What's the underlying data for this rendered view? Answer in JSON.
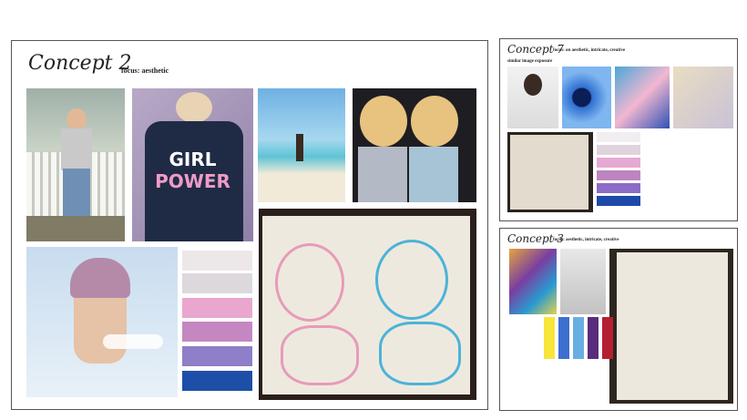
{
  "board_main": {
    "title": "Concept 2",
    "focus": "focus: aesthetic",
    "swatches": [
      "#ede7ea",
      "#dcd8db",
      "#e9a6cf",
      "#c487c1",
      "#8f7ec8",
      "#1e4fa8"
    ],
    "photos": [
      {
        "name": "girl-fence-photo",
        "text": ""
      },
      {
        "name": "girl-power-jacket-photo",
        "text": "GIRL\nPOWER"
      },
      {
        "name": "beach-photo",
        "text": ""
      },
      {
        "name": "twins-sunglasses-photo",
        "text": ""
      },
      {
        "name": "bandana-girl-photo",
        "text": ""
      },
      {
        "name": "sketchbook-drawing-photo",
        "text": ""
      }
    ]
  },
  "board_top_right": {
    "title": "Concept 7",
    "focus": "focus: on aesthetic, intricate, creative",
    "sub": "similar image exposure",
    "swatches": [
      "#f0eef0",
      "#e0d4dc",
      "#e6a9d3",
      "#be84bf",
      "#8c6cc6",
      "#1d49a8"
    ]
  },
  "board_bottom_right": {
    "title": "Concept 3",
    "focus": "focus: aesthetic, intricate, creative",
    "swatches": [
      "#f7e53a",
      "#3c6fcf",
      "#68aee2",
      "#5a2c7c",
      "#b51f31"
    ]
  }
}
